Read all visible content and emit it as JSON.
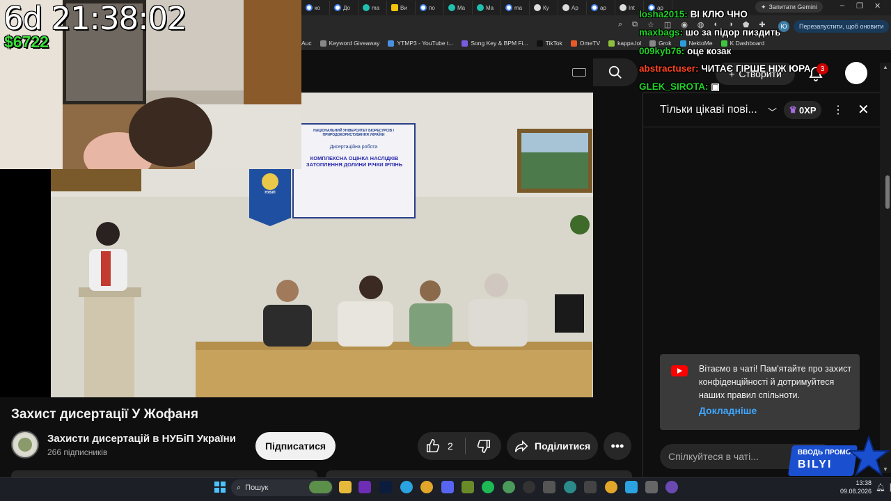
{
  "browser": {
    "tabs": [
      "ко",
      "До",
      "ma",
      "Ви",
      "по",
      "Ma",
      "Ma",
      "ma",
      "Ку",
      "Ар",
      "ар",
      "Int",
      "ap"
    ],
    "gemini_label": "Запитати Gemini",
    "relaunch_label": "Перезапустити, щоб оновити",
    "profile_initial": "Ю",
    "bookmarks": [
      "Auc",
      "Keyword Giveaway",
      "YTMP3 - YouTube t...",
      "Song Key & BPM Fi...",
      "TikTok",
      "OmeTV",
      "kappa.lol",
      "Grok",
      "NektoMe",
      "K Dashboard"
    ]
  },
  "youtube": {
    "create_label": "Створити",
    "notification_count": "3",
    "video_title": "Захист дисертації У Жофаня",
    "channel_name": "Захисти дисертацій в НУБіП України",
    "subscribers": "266 підписників",
    "subscribe_label": "Підписатися",
    "like_count": "2",
    "share_label": "Поділитися",
    "slide": {
      "university": "НАЦІОНАЛЬНИЙ УНІВЕРСИТЕТ БІОРЕСУРСІВ І ПРИРОДОКОРИСТУВАННЯ УКРАЇНИ",
      "kind": "Дисертаційна робота",
      "topic": "КОМПЛЕКСНА ОЦІНКА НАСЛІДКІВ ЗАТОПЛЕННЯ ДОЛИНИ РІЧКИ ІРПІНЬ",
      "logo_text": "НУБіП"
    }
  },
  "chat": {
    "mode_label": "Тільки цікаві пові...",
    "xp_label": "0XP",
    "welcome_text": "Вітаємо в чаті! Пам'ятайте про захист конфіденційності й дотримуйтеся наших правил спільноти.",
    "learn_more": "Докладніше",
    "input_placeholder": "Спілкуйтеся в чаті..."
  },
  "stream_overlay": {
    "timer": "6d 21:38:02",
    "money": "$6722",
    "messages": [
      {
        "user": "losha2015:",
        "text": "ВІ КЛЮ ЧНО",
        "color": "#22d02a"
      },
      {
        "user": "maxbags:",
        "text": "шо за підор пиздить",
        "color": "#22d02a"
      },
      {
        "user": "009kyb76:",
        "text": "оце козак",
        "color": "#22d02a"
      },
      {
        "user": "abstractuser:",
        "text": "ЧИТАЄ ГІРШЕ НІЖ ЮРА",
        "color": "#ff4422"
      },
      {
        "user": "GLEK_SIROTA:",
        "text": "",
        "color": "#22d02a"
      }
    ],
    "promo_line1": "ВВОДЬ ПРОМО:",
    "promo_line2": "BILYI"
  },
  "taskbar": {
    "search_label": "Пошук",
    "time": "13:38",
    "date": "09.08.2026"
  }
}
